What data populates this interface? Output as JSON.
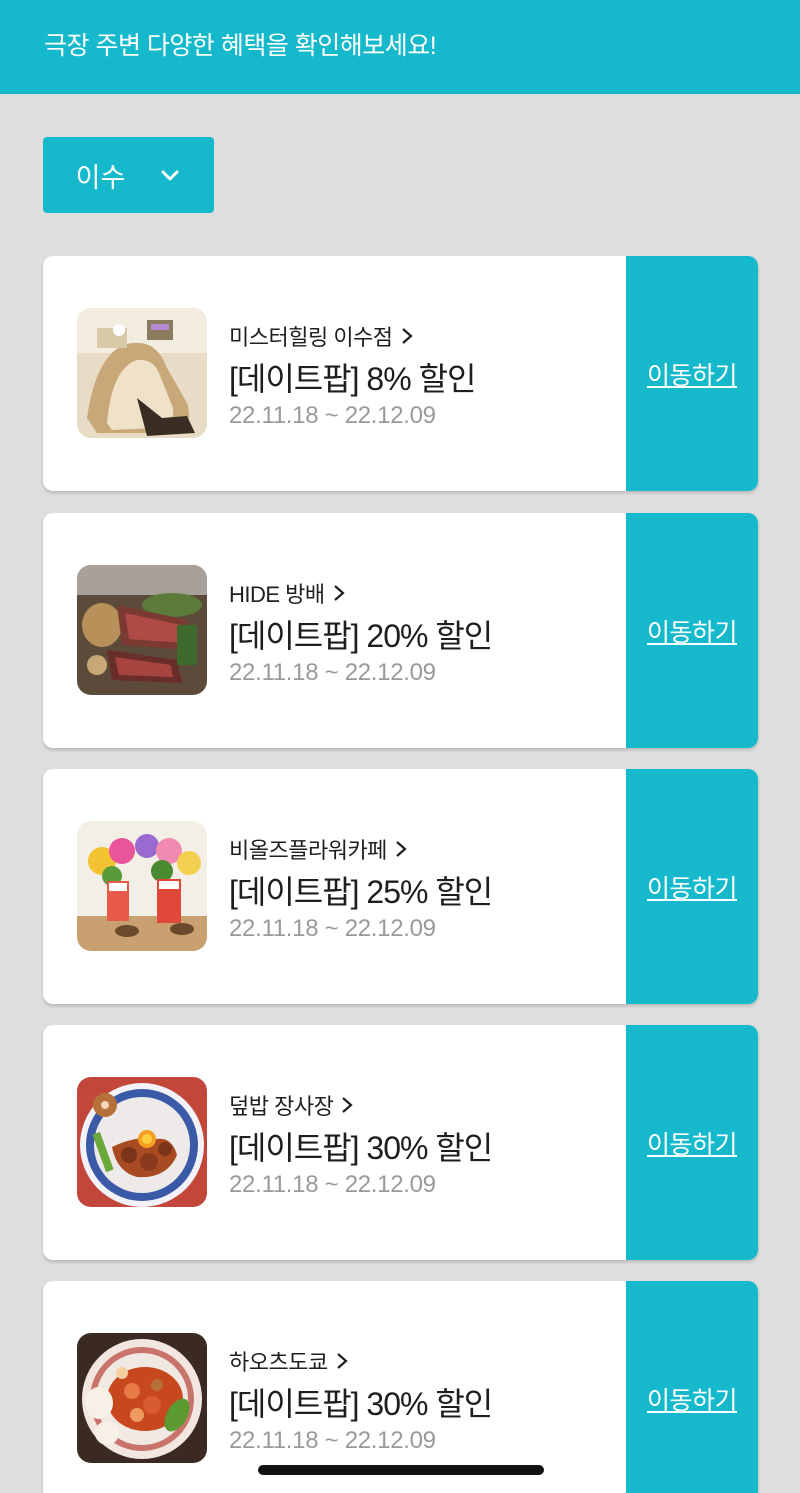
{
  "header": {
    "text": "극장 주변 다양한 혜택을 확인해보세요!"
  },
  "filter": {
    "selected": "이수",
    "icon": "chevron-down-icon"
  },
  "colors": {
    "accent": "#16b9cb",
    "background": "#dedede",
    "card": "#ffffff",
    "period_text": "#9a9a9a"
  },
  "offers": [
    {
      "store": "미스터힐링 이수점",
      "title": "[데이트팝] 8% 할인",
      "period": "22.11.18 ~ 22.12.09",
      "action": "이동하기",
      "image": "massage-chair-photo"
    },
    {
      "store": "HIDE 방배",
      "title": "[데이트팝] 20% 할인",
      "period": "22.11.18 ~ 22.12.09",
      "action": "이동하기",
      "image": "steak-photo"
    },
    {
      "store": "비올즈플라워카페",
      "title": "[데이트팝] 25% 할인",
      "period": "22.11.18 ~ 22.12.09",
      "action": "이동하기",
      "image": "flower-cafe-photo"
    },
    {
      "store": "덮밥 장사장",
      "title": "[데이트팝] 30% 할인",
      "period": "22.11.18 ~ 22.12.09",
      "action": "이동하기",
      "image": "rice-bowl-photo"
    },
    {
      "store": "하오츠도쿄",
      "title": "[데이트팝] 30% 할인",
      "period": "22.11.18 ~ 22.12.09",
      "action": "이동하기",
      "image": "chinese-dish-photo"
    }
  ]
}
